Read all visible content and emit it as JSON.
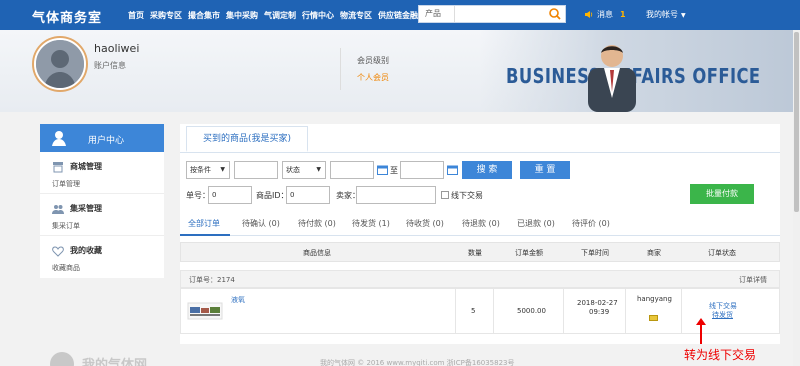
{
  "topnav": {
    "logo": "气体商务室",
    "links": [
      "首页",
      "采购专区",
      "撮合集市",
      "集中采购",
      "气调定制",
      "行情中心",
      "物流专区",
      "供应链金融"
    ],
    "search": {
      "category": "产品",
      "placeholder": ""
    },
    "messages": {
      "label": "消息",
      "count": "1"
    },
    "account": "我的帐号"
  },
  "banner": {
    "username": "haoliwei",
    "user_info": "账户信息",
    "level_label": "会员级别",
    "level_value": "个人会员",
    "slogan": "BUSINESS AFFAIRS OFFICE"
  },
  "sidebar": {
    "header": "用户中心",
    "sections": [
      {
        "title": "商城管理",
        "sub": "订单管理"
      },
      {
        "title": "集采管理",
        "sub": "集采订单"
      },
      {
        "title": "我的收藏",
        "sub": "收藏商品"
      }
    ]
  },
  "main": {
    "tab_title": "买到的商品(我是买家)",
    "filters": {
      "condition": "按条件",
      "status": "状态",
      "to": "至",
      "search_btn": "搜 索",
      "reset_btn": "重 置",
      "order_no_label": "单号：",
      "order_no_value": "0",
      "product_id_label": "商品ID：",
      "product_id_value": "0",
      "seller_label": "卖家：",
      "offline_label": "线下交易",
      "batch_pay_btn": "批量付款"
    },
    "status_tabs": [
      "全部订单",
      "待确认 (0)",
      "待付款 (0)",
      "待发货 (1)",
      "待收货 (0)",
      "待退款 (0)",
      "已退款 (0)",
      "待评价 (0)"
    ],
    "table_headers": [
      "商品信息",
      "数量",
      "订单金额",
      "下单时间",
      "商家",
      "订单状态"
    ],
    "order": {
      "order_no": "订单号：2174",
      "detail": "订单详情",
      "product_name": "液氧",
      "quantity": "5",
      "amount": "5000.00",
      "date": "2018-02-27",
      "time": "09:39",
      "merchant": "hangyang",
      "status_line1": "线下交易",
      "status_line2": "待发货"
    }
  },
  "annotation": "转为线下交易",
  "footer": "我的气体网 © 2016 www.myqiti.com 浙ICP备16035823号",
  "footer_logo": "我的气体网",
  "colors": {
    "nav": "#1f63b4",
    "accent": "#3d86d8",
    "orange": "#f08300",
    "green": "#3bb54a",
    "annotation": "#ee0000"
  }
}
